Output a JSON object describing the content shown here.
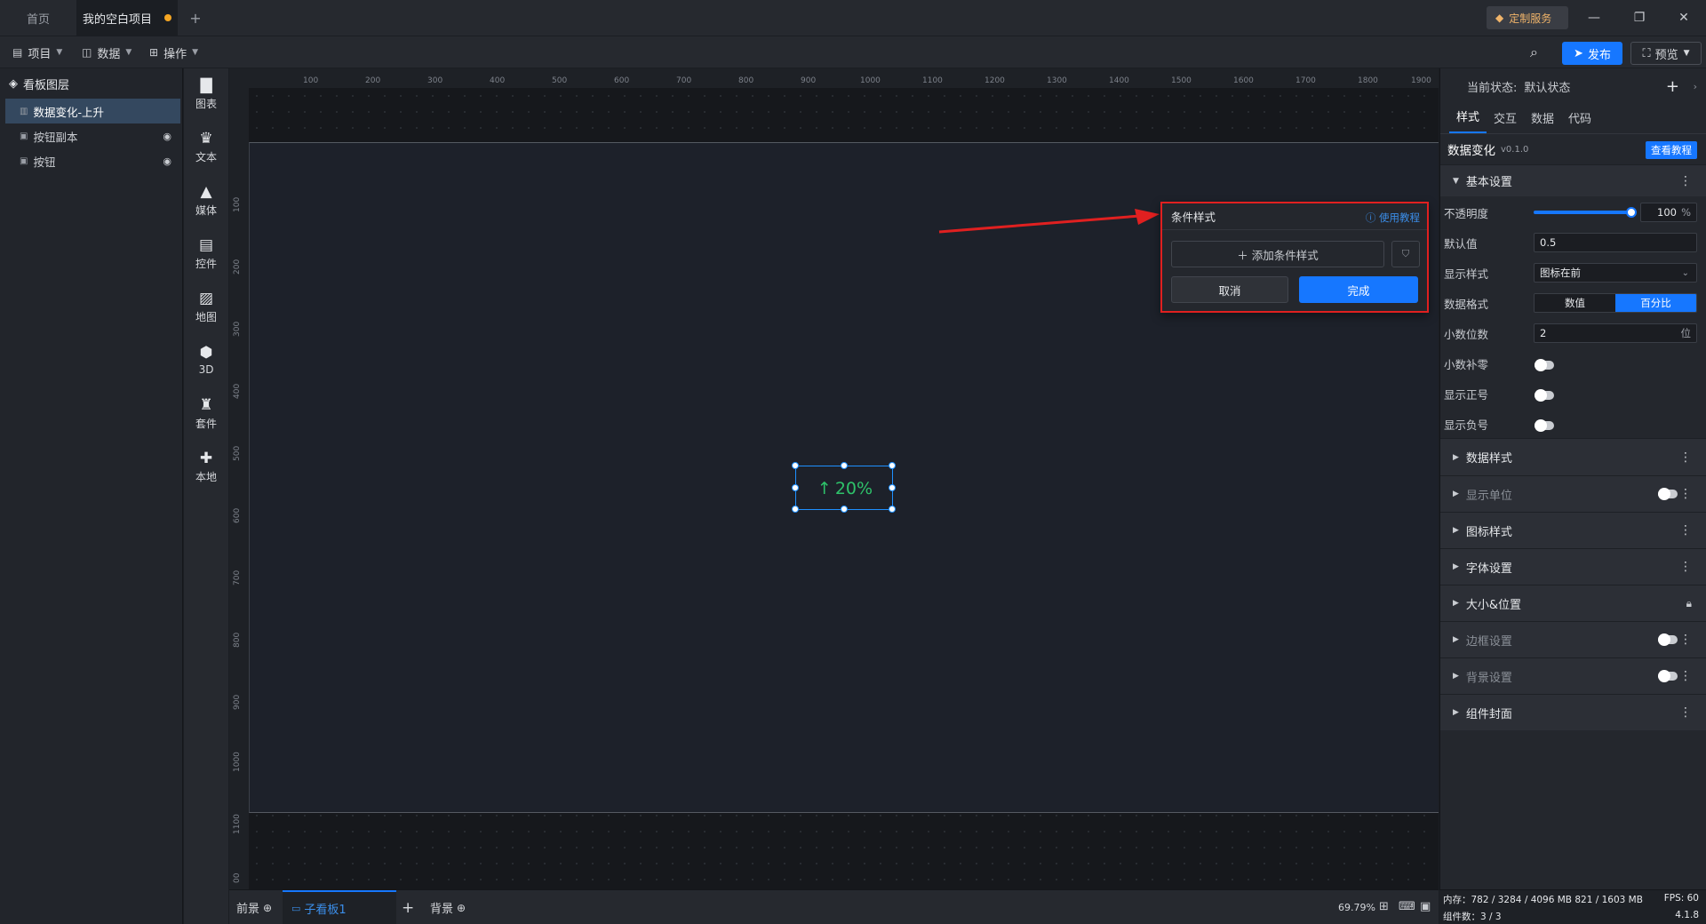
{
  "titlebar": {
    "tab_home": "首页",
    "tab_project": "我的空白项目",
    "add_tab": "+",
    "custom_service": "定制服务"
  },
  "toolbar": {
    "project": "项目",
    "data": "数据",
    "operate": "操作",
    "publish": "发布",
    "preview": "预览"
  },
  "layers": {
    "title": "看板图层",
    "items": [
      {
        "label": "数据变化-上升"
      },
      {
        "label": "按钮副本"
      },
      {
        "label": "按钮"
      }
    ]
  },
  "components": [
    {
      "label": "图表",
      "icon": "chart-icon"
    },
    {
      "label": "文本",
      "icon": "text-icon"
    },
    {
      "label": "媒体",
      "icon": "media-icon"
    },
    {
      "label": "控件",
      "icon": "widget-icon"
    },
    {
      "label": "地图",
      "icon": "map-icon"
    },
    {
      "label": "3D",
      "icon": "cube-icon"
    },
    {
      "label": "套件",
      "icon": "kit-icon"
    },
    {
      "label": "本地",
      "icon": "puzzle-icon"
    }
  ],
  "ruler": {
    "top": [
      "100",
      "200",
      "300",
      "400",
      "500",
      "600",
      "700",
      "800",
      "900",
      "1000",
      "1100",
      "1200",
      "1300",
      "1400",
      "1500",
      "1600",
      "1700",
      "1800",
      "1900"
    ],
    "left": [
      "100",
      "200",
      "300",
      "400",
      "500",
      "600",
      "700",
      "800",
      "900",
      "1000",
      "1100",
      "00"
    ]
  },
  "widget": {
    "arrow": "↑",
    "value": "20%",
    "color": "#2ec26a"
  },
  "popup": {
    "title": "条件样式",
    "help": "使用教程",
    "add": "添加条件样式",
    "cancel": "取消",
    "done": "完成"
  },
  "bottom": {
    "foreground": "前景",
    "board": "子看板1",
    "background": "背景",
    "zoom": "69.79%"
  },
  "rpanel": {
    "state_label": "当前状态:",
    "state_value": "默认状态",
    "tabs": [
      "样式",
      "交互",
      "数据",
      "代码"
    ],
    "component_name": "数据变化",
    "version": "v0.1.0",
    "tutorial": "查看教程",
    "basic": {
      "title": "基本设置",
      "opacity_label": "不透明度",
      "opacity_value": "100",
      "opacity_unit": "%",
      "opacity_level": 100,
      "default_label": "默认值",
      "default_value": "0.5",
      "display_label": "显示样式",
      "display_value": "图标在前",
      "format_label": "数据格式",
      "format_options": [
        "数值",
        "百分比"
      ],
      "decimals_label": "小数位数",
      "decimals_value": "2",
      "decimals_unit": "位",
      "pad_label": "小数补零",
      "positive_label": "显示正号",
      "negative_label": "显示负号"
    },
    "sections": [
      {
        "title": "数据样式",
        "dim": false,
        "toggle": false
      },
      {
        "title": "显示单位",
        "dim": true,
        "toggle": true
      },
      {
        "title": "图标样式",
        "dim": false,
        "toggle": false
      },
      {
        "title": "字体设置",
        "dim": false,
        "toggle": false
      },
      {
        "title": "大小&位置",
        "dim": false,
        "toggle": false,
        "lock": true
      },
      {
        "title": "边框设置",
        "dim": true,
        "toggle": true
      },
      {
        "title": "背景设置",
        "dim": true,
        "toggle": true
      },
      {
        "title": "组件封面",
        "dim": false,
        "toggle": false
      }
    ]
  },
  "status": {
    "memory": "内存：782 / 3284 / 4096 MB  821 / 1603 MB",
    "fps": "FPS: 60",
    "count": "组件数：3 / 3",
    "version": "4.1.8"
  }
}
